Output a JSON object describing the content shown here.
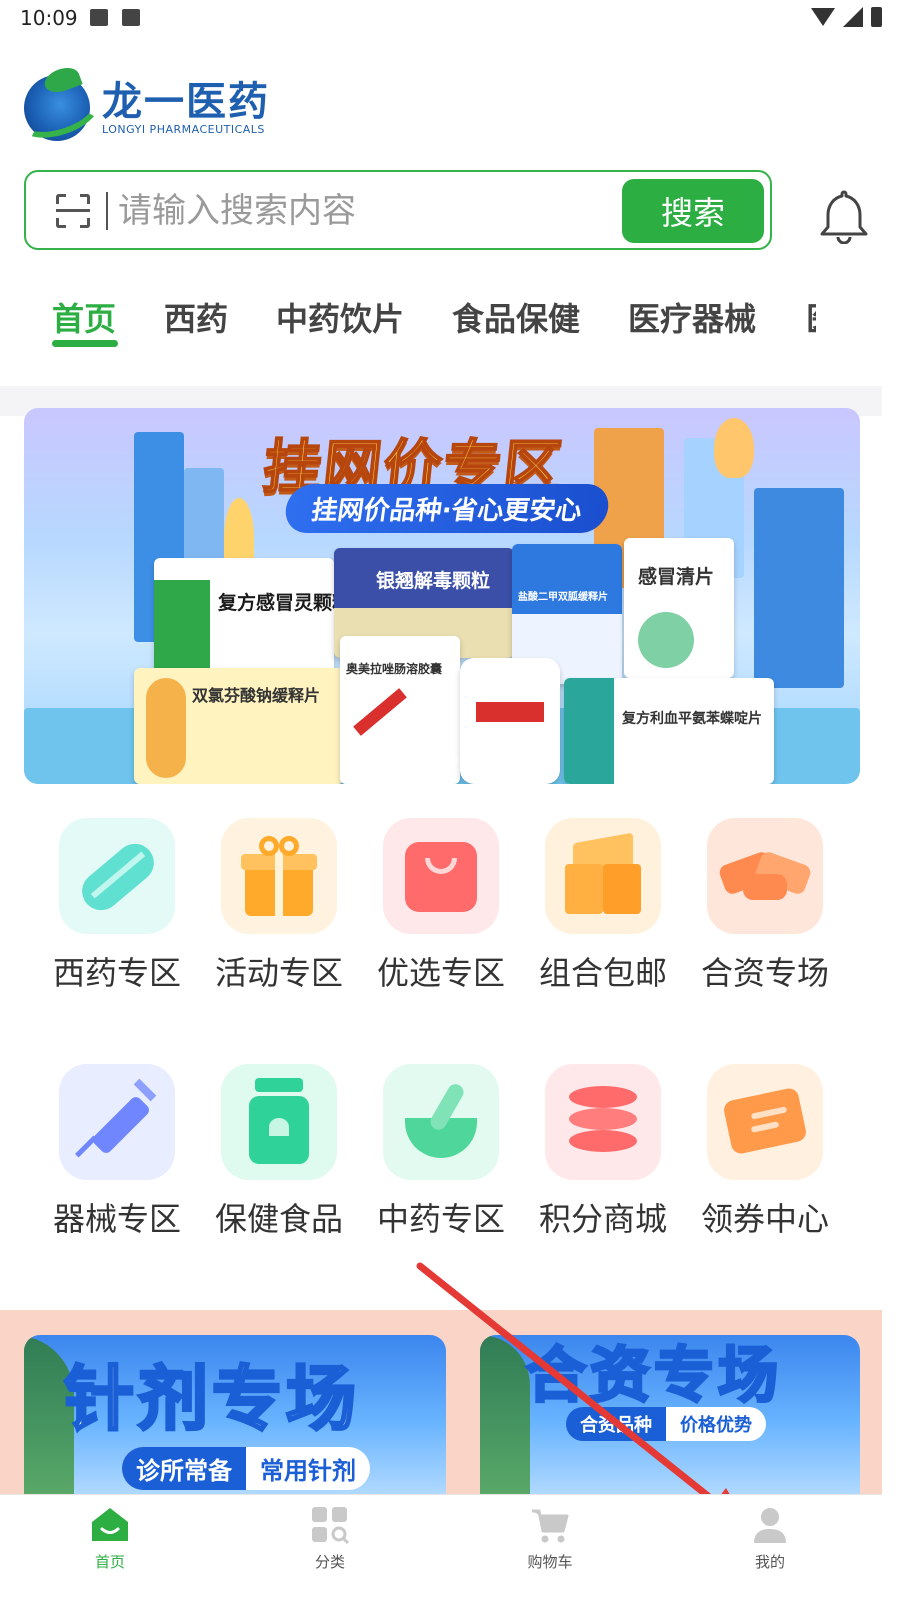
{
  "status_bar": {
    "time": "10:09"
  },
  "logo": {
    "name_cn": "龙一医药",
    "name_en": "LONGYI PHARMACEUTICALS"
  },
  "search": {
    "placeholder": "请输入搜索内容",
    "value": "",
    "button_label": "搜索"
  },
  "tabs": [
    {
      "label": "首页",
      "active": true
    },
    {
      "label": "西药",
      "active": false
    },
    {
      "label": "中药饮片",
      "active": false
    },
    {
      "label": "食品保健",
      "active": false
    },
    {
      "label": "医疗器械",
      "active": false
    }
  ],
  "banner": {
    "title": "挂网价专区",
    "subtitle": "挂网价品种·省心更安心",
    "products": [
      "复方感冒灵颗粒",
      "银翘解毒颗粒",
      "盐酸二甲双胍缓释片",
      "感冒清片",
      "双氯芬酸钠缓释片",
      "奥美拉唑肠溶胶囊",
      "复方利血平氨苯蝶啶片"
    ],
    "slide_count": 6,
    "active_slide": 0
  },
  "categories": [
    {
      "label": "西药专区",
      "icon": "capsule-icon",
      "color": "#5fe0d0",
      "bg": "#e3faf6"
    },
    {
      "label": "活动专区",
      "icon": "gift-icon",
      "color": "#ffaa2a",
      "bg": "#fff2de"
    },
    {
      "label": "优选专区",
      "icon": "shopping-bag-icon",
      "color": "#ff6b6b",
      "bg": "#ffe8ea"
    },
    {
      "label": "组合包邮",
      "icon": "package-box-icon",
      "color": "#ffb040",
      "bg": "#fff1dc"
    },
    {
      "label": "合资专场",
      "icon": "handshake-icon",
      "color": "#ff8a50",
      "bg": "#ffe6da"
    },
    {
      "label": "器械专区",
      "icon": "syringe-icon",
      "color": "#6f86ff",
      "bg": "#e8edff"
    },
    {
      "label": "保健食品",
      "icon": "health-jar-icon",
      "color": "#2fd39a",
      "bg": "#dffaee"
    },
    {
      "label": "中药专区",
      "icon": "mortar-pestle-icon",
      "color": "#4fd69a",
      "bg": "#e3faf0"
    },
    {
      "label": "积分商城",
      "icon": "coins-stack-icon",
      "color": "#ff6b6b",
      "bg": "#ffe8ea"
    },
    {
      "label": "领券中心",
      "icon": "coupon-icon",
      "color": "#ff9a4a",
      "bg": "#fff0e0"
    }
  ],
  "promos": [
    {
      "title": "针剂专场",
      "tag_left": "诊所常备",
      "tag_right": "常用针剂"
    },
    {
      "title": "合资专场",
      "tag_left": "合资品种",
      "tag_right": "价格优势"
    }
  ],
  "bottom_nav": [
    {
      "label": "首页",
      "icon": "home-icon",
      "active": true
    },
    {
      "label": "分类",
      "icon": "category-grid-icon",
      "active": false
    },
    {
      "label": "购物车",
      "icon": "cart-icon",
      "active": false
    },
    {
      "label": "我的",
      "icon": "user-icon",
      "active": false
    }
  ],
  "colors": {
    "accent": "#2dae43",
    "logo_blue": "#1f5fb0",
    "annotation_arrow": "#e53935"
  }
}
